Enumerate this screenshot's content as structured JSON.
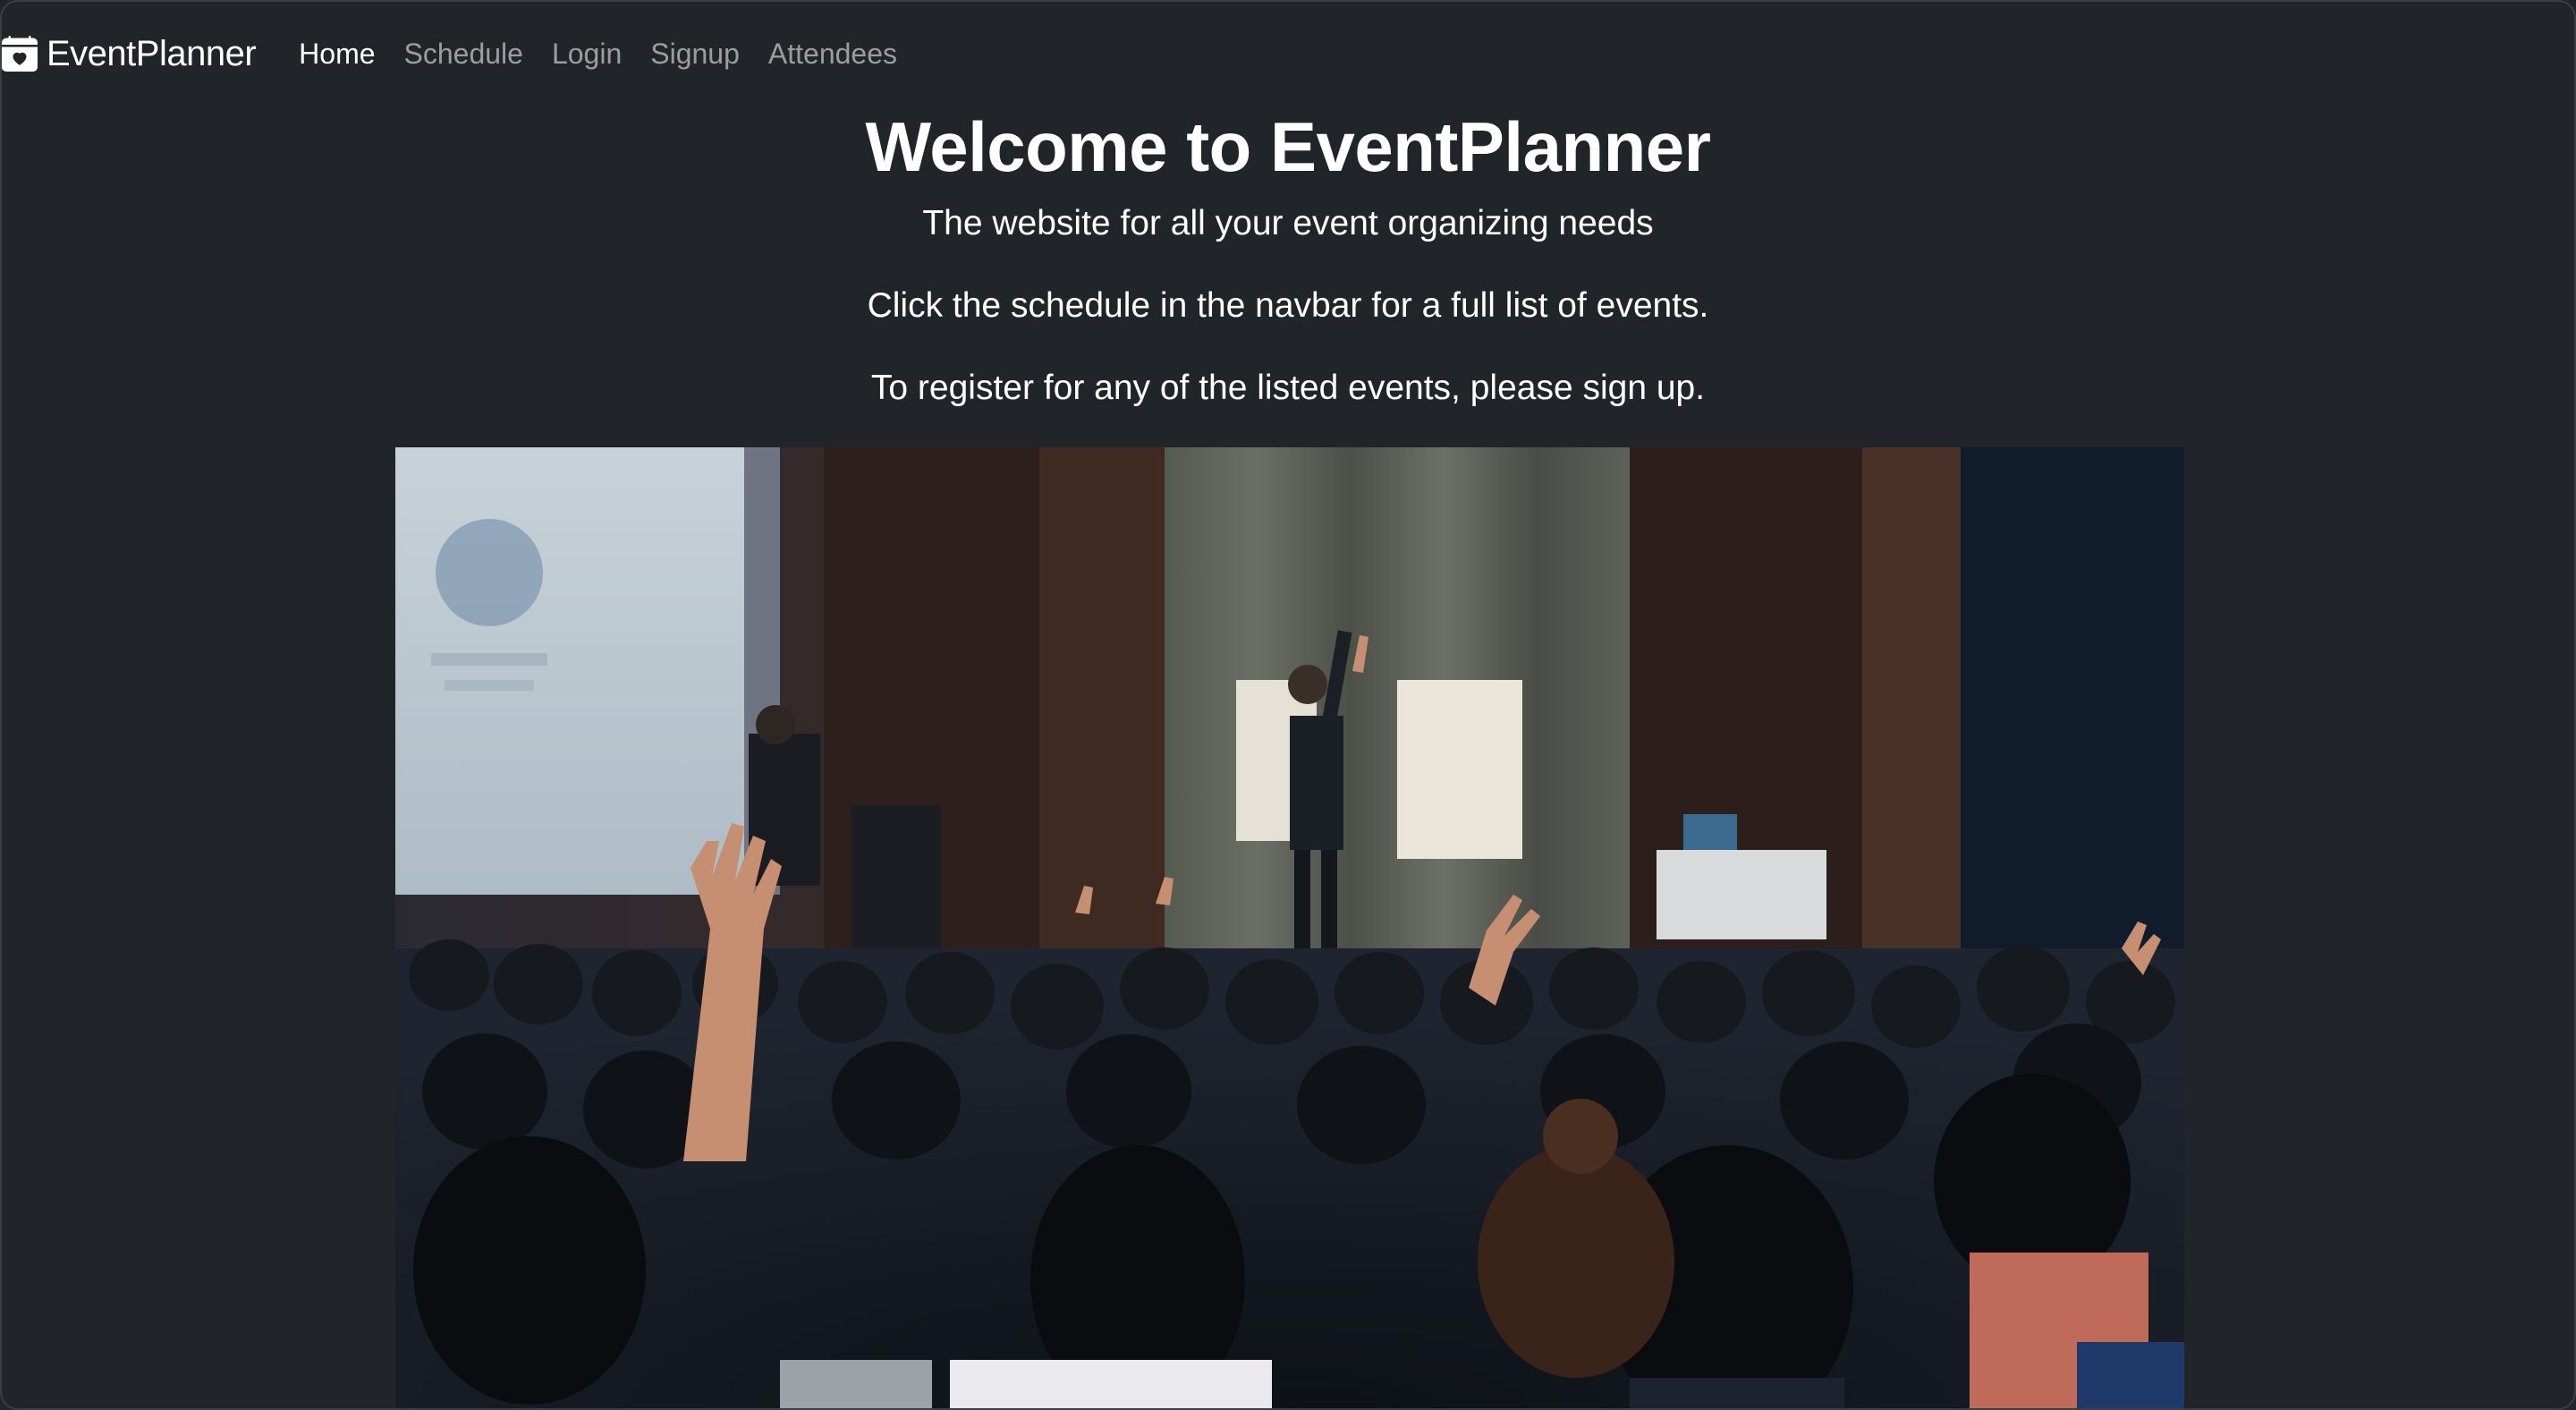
{
  "brand": {
    "name": "EventPlanner",
    "icon": "calendar-heart-icon"
  },
  "nav": {
    "items": [
      {
        "label": "Home",
        "active": true
      },
      {
        "label": "Schedule",
        "active": false
      },
      {
        "label": "Login",
        "active": false
      },
      {
        "label": "Signup",
        "active": false
      },
      {
        "label": "Attendees",
        "active": false
      }
    ]
  },
  "hero": {
    "title": "Welcome to EventPlanner",
    "tagline": "The website for all your event organizing needs",
    "line2": "Click the schedule in the navbar for a full list of events.",
    "line3": "To register for any of the listed events, please sign up."
  },
  "colors": {
    "background": "#212529",
    "nav_active": "#ffffff",
    "nav_inactive": "rgba(255,255,255,0.55)"
  }
}
